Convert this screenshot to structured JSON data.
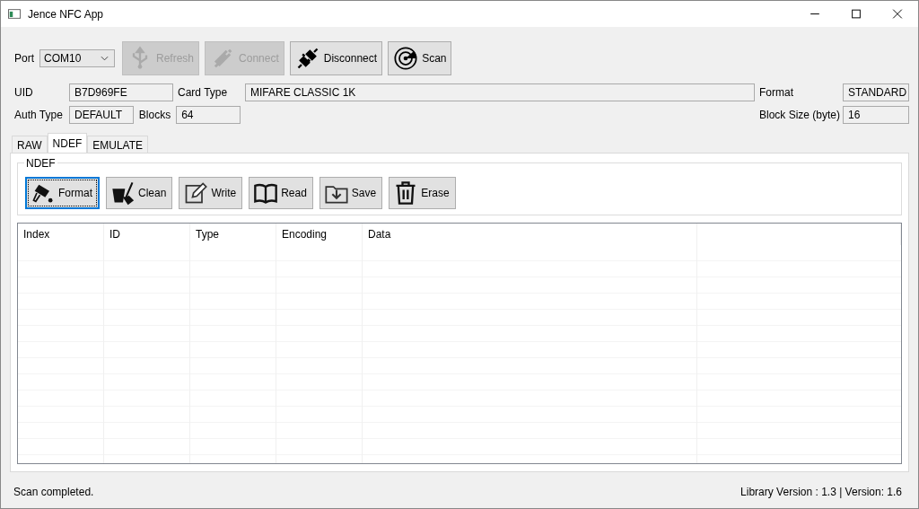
{
  "window": {
    "title": "Jence NFC App"
  },
  "toolbar": {
    "port_label": "Port",
    "port_value": "COM10",
    "buttons": [
      {
        "label": "Refresh",
        "disabled": true
      },
      {
        "label": "Connect",
        "disabled": true
      },
      {
        "label": "Disconnect",
        "disabled": false
      },
      {
        "label": "Scan",
        "disabled": false
      }
    ]
  },
  "info": {
    "uid_label": "UID",
    "uid": "B7D969FE",
    "card_type_label": "Card Type",
    "card_type": "MIFARE CLASSIC 1K",
    "format_label": "Format",
    "format": "STANDARD",
    "auth_type_label": "Auth Type",
    "auth_type": "DEFAULT",
    "blocks_label": "Blocks",
    "blocks": "64",
    "block_size_label": "Block Size (byte)",
    "block_size": "16"
  },
  "tabs": [
    {
      "label": "RAW",
      "selected": false
    },
    {
      "label": "NDEF",
      "selected": true
    },
    {
      "label": "EMULATE",
      "selected": false
    }
  ],
  "ndef_group": {
    "title": "NDEF",
    "buttons": [
      {
        "label": "Format",
        "focused": true
      },
      {
        "label": "Clean",
        "focused": false
      },
      {
        "label": "Write",
        "focused": false
      },
      {
        "label": "Read",
        "focused": false
      },
      {
        "label": "Save",
        "focused": false
      },
      {
        "label": "Erase",
        "focused": false
      }
    ]
  },
  "table": {
    "columns": [
      "Index",
      "ID",
      "Type",
      "Encoding",
      "Data"
    ]
  },
  "status_bar": {
    "message": "Scan completed.",
    "version": "Library Version : 1.3 | Version: 1.6"
  }
}
